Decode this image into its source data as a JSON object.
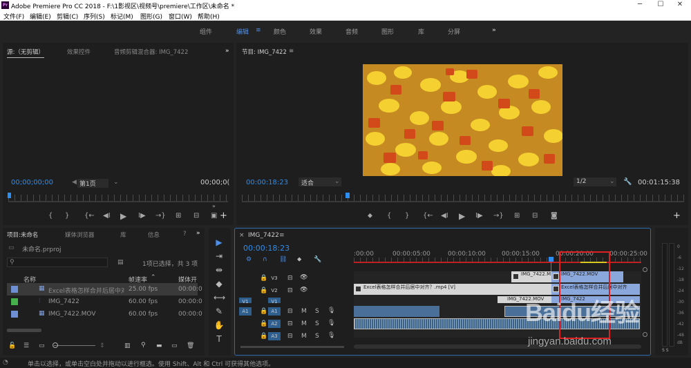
{
  "title_bar": {
    "title": "Adobe Premiere Pro CC 2018 - F:\\1影视区\\视频号\\premiere\\工作区\\未命名 *",
    "app_icon": "Pr"
  },
  "menu": [
    "文件(F)",
    "编辑(E)",
    "剪辑(C)",
    "序列(S)",
    "标记(M)",
    "图形(G)",
    "窗口(W)",
    "帮助(H)"
  ],
  "workspaces": [
    "组件",
    "编辑",
    "颜色",
    "效果",
    "音频",
    "图形",
    "库",
    "分屏"
  ],
  "source": {
    "tabs": [
      "源:（无剪辑）",
      "效果控件",
      "音频剪辑混合器: IMG_7422"
    ],
    "timecode_left": "00;00;00;00",
    "page": "第1页",
    "timecode_right": "00;00;0("
  },
  "program": {
    "tab": "节目: IMG_7422",
    "timecode": "00:00:18:23",
    "fit": "适合",
    "quality": "1/2",
    "duration": "00:01:15:38"
  },
  "project": {
    "tabs": [
      "项目:未命名",
      "媒体浏览器",
      "库",
      "信息",
      "?"
    ],
    "file": "未命名.prproj",
    "selection": "1项已选择，共 3 项",
    "search_placeholder": "",
    "columns": [
      "名称",
      "帧速率",
      "媒体开始"
    ],
    "rows": [
      {
        "name": "Excel表格怎样合并后居中对齐？",
        "fps": "25.00 fps",
        "start": "00:00:0",
        "color": "#6e8fd4"
      },
      {
        "name": "IMG_7422",
        "fps": "60.00 fps",
        "start": "00:00:0",
        "color": "#46b04a"
      },
      {
        "name": "IMG_7422.MOV",
        "fps": "60.00 fps",
        "start": "00:00:0",
        "color": "#6e8fd4"
      }
    ]
  },
  "timeline": {
    "tab": "IMG_7422",
    "timecode": "00:00:18:23",
    "ruler": [
      ":00:00",
      "00:00:05:00",
      "00:00:10:00",
      "00:00:15:00",
      "00:00:20:00",
      "00:00:25:00"
    ],
    "tracks": [
      "V3",
      "V2",
      "V1",
      "A1",
      "A2",
      "A3"
    ],
    "target_labels": [
      "V1",
      "A1"
    ],
    "track_buttons": {
      "mute": "M",
      "solo": "S"
    },
    "clips": {
      "v3_a": "IMG_7422.M",
      "v3_b": "IMG_7422.MOV",
      "v2_a": "Excel表格怎样合并后居中对齐？.mp4 [V]",
      "v2_b": "Excel表格怎样合并后居中对齐",
      "v1_a": "IMG_7422.MOV",
      "v1_b": "IMG_7422"
    }
  },
  "status": "单击以选择，或单击空白处并拖动以进行框选。使用 Shift、Alt 和 Ctrl 可获得其他选项。",
  "meter_labels": [
    "0",
    "-6",
    "-12",
    "-18",
    "-24",
    "-30",
    "-36",
    "-42",
    "-48",
    "dB"
  ],
  "meter_bottom": "S S",
  "watermark": {
    "brand": "Baidu经验",
    "url": "jingyan.baidu.com"
  },
  "colors": {
    "accent": "#2c8ef0",
    "highlight_box": "#e02020",
    "playhead": "#2c8ef0"
  }
}
